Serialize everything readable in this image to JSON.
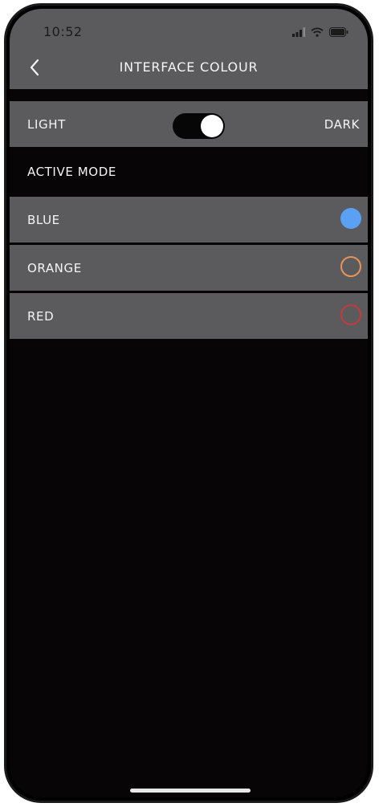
{
  "status_bar": {
    "time": "10:52",
    "icons": [
      "cellular-signal-icon",
      "wifi-icon",
      "battery-icon"
    ]
  },
  "nav": {
    "back_icon": "chevron-left-icon",
    "title": "INTERFACE COLOUR"
  },
  "theme_toggle": {
    "left_label": "LIGHT",
    "right_label": "DARK",
    "selected": "DARK"
  },
  "active_mode": {
    "title": "ACTIVE MODE",
    "options": [
      {
        "label": "BLUE",
        "color": "#5aa0f3",
        "selected": true
      },
      {
        "label": "ORANGE",
        "color": "#e8935a",
        "selected": false
      },
      {
        "label": "RED",
        "color": "#c43a3e",
        "selected": false
      }
    ]
  },
  "colors": {
    "bar_gray": "#5b5b5d",
    "background": "#070506",
    "text": "#f4f4f4"
  }
}
